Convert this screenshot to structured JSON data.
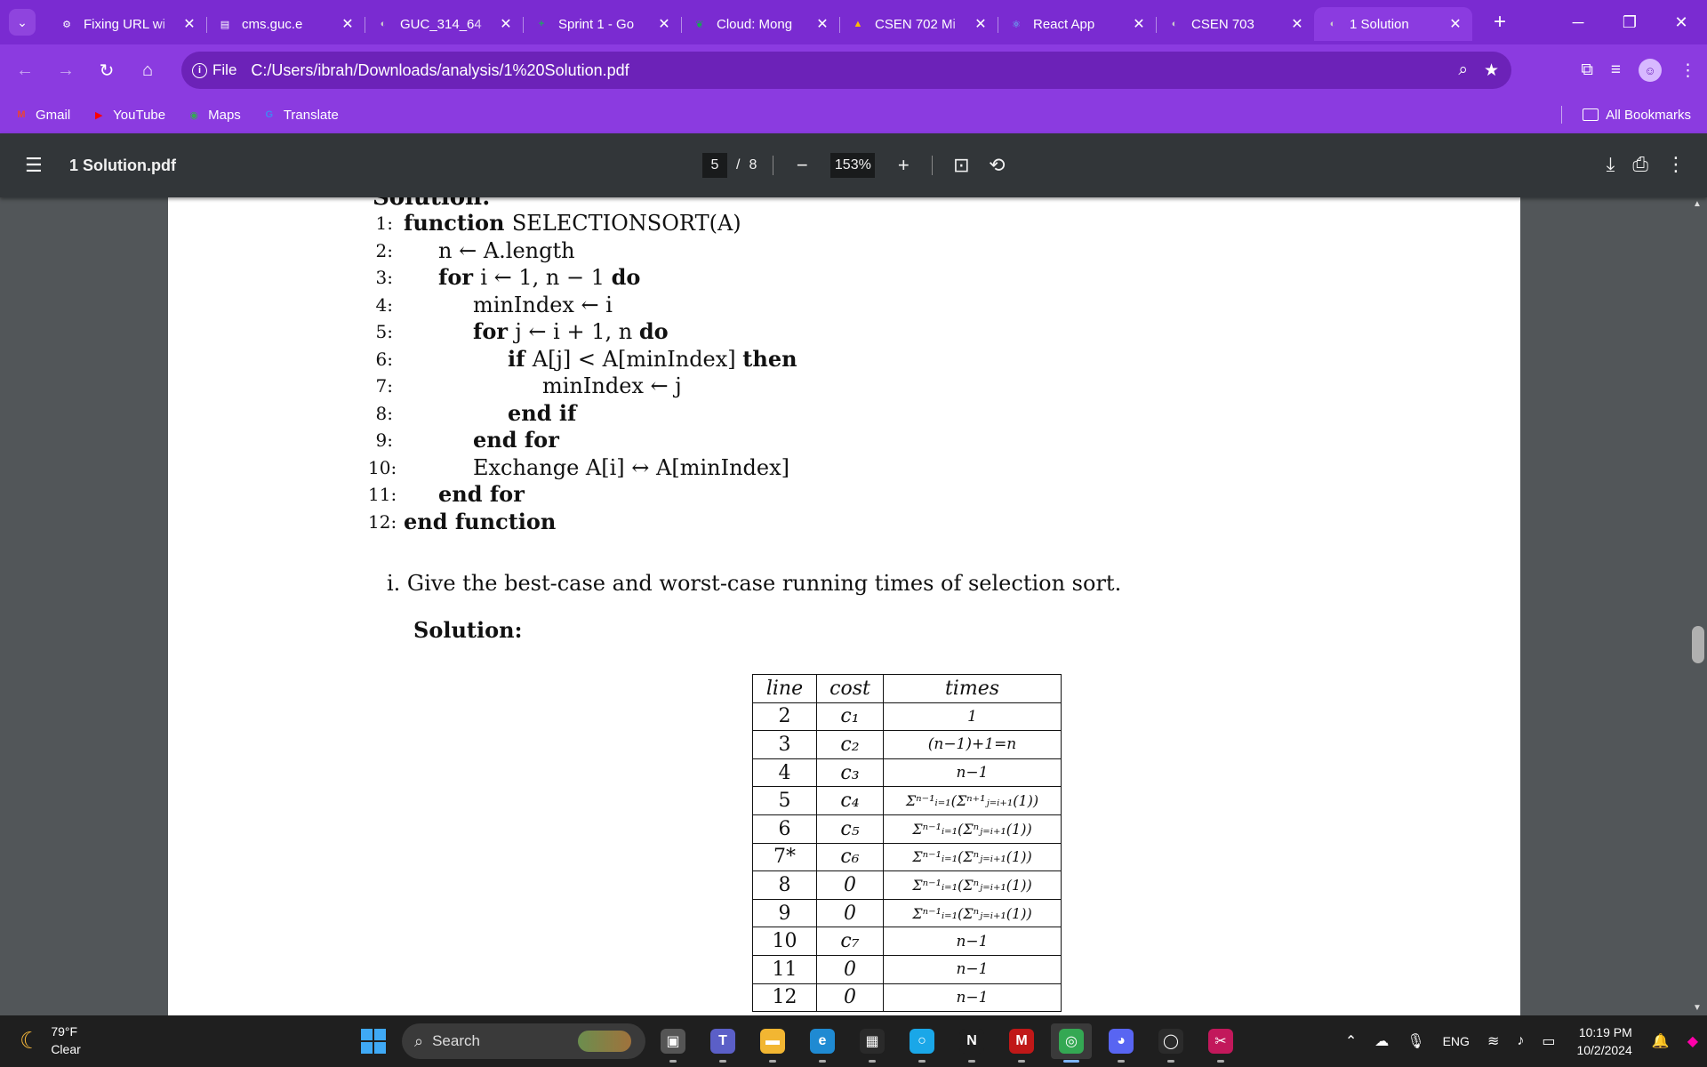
{
  "browser": {
    "tabs": [
      {
        "title": "Fixing URL wi",
        "icon": "openai-icon",
        "color": "#ffffff",
        "glyph": "⚙"
      },
      {
        "title": "cms.guc.e",
        "icon": "document-icon",
        "color": "#ffffff",
        "glyph": "▤"
      },
      {
        "title": "GUC_314_64",
        "icon": "globe-icon",
        "color": "#cccccc",
        "glyph": "◐"
      },
      {
        "title": "Sprint 1 - Go",
        "icon": "sheets-icon",
        "color": "#1fa463",
        "glyph": "+"
      },
      {
        "title": "Cloud: Mong",
        "icon": "mongodb-icon",
        "color": "#13aa52",
        "glyph": "❦"
      },
      {
        "title": "CSEN 702 Mi",
        "icon": "drive-icon",
        "color": "#fbbc04",
        "glyph": "▲"
      },
      {
        "title": "React App",
        "icon": "react-icon",
        "color": "#61dafb",
        "glyph": "⚛"
      },
      {
        "title": "CSEN 703",
        "icon": "globe-icon",
        "color": "#cccccc",
        "glyph": "◐"
      },
      {
        "title": "1 Solution",
        "icon": "globe-icon",
        "color": "#cccccc",
        "glyph": "◐",
        "active": true
      }
    ],
    "address": {
      "chip_label": "File",
      "url": "C:/Users/ibrah/Downloads/analysis/1%20Solution.pdf"
    },
    "bookmarks": [
      {
        "label": "Gmail",
        "icon": "gmail-icon",
        "glyph": "M",
        "color": "#ea4335"
      },
      {
        "label": "YouTube",
        "icon": "youtube-icon",
        "glyph": "▶",
        "color": "#ff0000"
      },
      {
        "label": "Maps",
        "icon": "maps-icon",
        "glyph": "◉",
        "color": "#34a853"
      },
      {
        "label": "Translate",
        "icon": "translate-icon",
        "glyph": "G",
        "color": "#4285f4"
      }
    ],
    "all_bookmarks_label": "All Bookmarks"
  },
  "pdf_viewer": {
    "file_name": "1 Solution.pdf",
    "current_page": "5",
    "page_separator": "/",
    "total_pages": "8",
    "zoom": "153%"
  },
  "document": {
    "clipped_heading": "Solution:",
    "algorithm": [
      {
        "n": "1:",
        "indent": 0,
        "parts": [
          {
            "b": true,
            "t": "function "
          },
          {
            "t": "SELECTIONSORT(A)"
          }
        ]
      },
      {
        "n": "2:",
        "indent": 1,
        "parts": [
          {
            "t": "n ← A.length"
          }
        ]
      },
      {
        "n": "3:",
        "indent": 1,
        "parts": [
          {
            "b": true,
            "t": "for "
          },
          {
            "t": "i ← 1, n − 1 "
          },
          {
            "b": true,
            "t": "do"
          }
        ]
      },
      {
        "n": "4:",
        "indent": 2,
        "parts": [
          {
            "t": "minIndex ← i"
          }
        ]
      },
      {
        "n": "5:",
        "indent": 2,
        "parts": [
          {
            "b": true,
            "t": "for "
          },
          {
            "t": "j ← i + 1, n "
          },
          {
            "b": true,
            "t": "do"
          }
        ]
      },
      {
        "n": "6:",
        "indent": 3,
        "parts": [
          {
            "b": true,
            "t": "if "
          },
          {
            "t": "A[j] < A[minIndex] "
          },
          {
            "b": true,
            "t": "then"
          }
        ]
      },
      {
        "n": "7:",
        "indent": 4,
        "parts": [
          {
            "t": "minIndex ← j"
          }
        ]
      },
      {
        "n": "8:",
        "indent": 3,
        "parts": [
          {
            "b": true,
            "t": "end if"
          }
        ]
      },
      {
        "n": "9:",
        "indent": 2,
        "parts": [
          {
            "b": true,
            "t": "end for"
          }
        ]
      },
      {
        "n": "10:",
        "indent": 2,
        "parts": [
          {
            "t": "Exchange A[i] ↔ A[minIndex]"
          }
        ]
      },
      {
        "n": "11:",
        "indent": 1,
        "parts": [
          {
            "b": true,
            "t": "end for"
          }
        ]
      },
      {
        "n": "12:",
        "indent": 0,
        "parts": [
          {
            "b": true,
            "t": "end function"
          }
        ]
      }
    ],
    "question": "i. Give the best-case and worst-case running times of selection sort.",
    "solution_label": "Solution:",
    "table": {
      "headers": [
        "line",
        "cost",
        "times"
      ],
      "rows": [
        {
          "line": "2",
          "cost": "c₁",
          "times": "1"
        },
        {
          "line": "3",
          "cost": "c₂",
          "times": "(n−1)+1=n"
        },
        {
          "line": "4",
          "cost": "c₃",
          "times": "n−1"
        },
        {
          "line": "5",
          "cost": "c₄",
          "times": "Σⁿ⁻¹ᵢ₌₁(Σⁿ⁺¹ⱼ₌ᵢ₊₁(1))"
        },
        {
          "line": "6",
          "cost": "c₅",
          "times": "Σⁿ⁻¹ᵢ₌₁(Σⁿⱼ₌ᵢ₊₁(1))"
        },
        {
          "line": "7*",
          "cost": "c₆",
          "times": "Σⁿ⁻¹ᵢ₌₁(Σⁿⱼ₌ᵢ₊₁(1))"
        },
        {
          "line": "8",
          "cost": "0",
          "times": "Σⁿ⁻¹ᵢ₌₁(Σⁿⱼ₌ᵢ₊₁(1))"
        },
        {
          "line": "9",
          "cost": "0",
          "times": "Σⁿ⁻¹ᵢ₌₁(Σⁿⱼ₌ᵢ₊₁(1))"
        },
        {
          "line": "10",
          "cost": "c₇",
          "times": "n−1"
        },
        {
          "line": "11",
          "cost": "0",
          "times": "n−1"
        },
        {
          "line": "12",
          "cost": "0",
          "times": "n−1"
        }
      ]
    }
  },
  "taskbar": {
    "temperature": "79°F",
    "condition": "Clear",
    "search_placeholder": "Search",
    "apps": [
      {
        "name": "task-view-icon",
        "glyph": "▣",
        "bg": "#555555"
      },
      {
        "name": "teams-icon",
        "glyph": "T",
        "bg": "#5b5fc7"
      },
      {
        "name": "file-explorer-icon",
        "glyph": "▬",
        "bg": "#f2b632"
      },
      {
        "name": "edge-icon",
        "glyph": "e",
        "bg": "#1f8ad2"
      },
      {
        "name": "store-icon",
        "glyph": "▦",
        "bg": "#2a2a2a"
      },
      {
        "name": "cortana-icon",
        "glyph": "○",
        "bg": "#1aa7e8"
      },
      {
        "name": "netflix-icon",
        "glyph": "N",
        "bg": "#1f1f1f"
      },
      {
        "name": "mcafee-icon",
        "glyph": "M",
        "bg": "#c01818"
      },
      {
        "name": "chrome-icon",
        "glyph": "◎",
        "bg": "#34a853",
        "active": true
      },
      {
        "name": "discord-icon",
        "glyph": "◕",
        "bg": "#5865f2"
      },
      {
        "name": "github-icon",
        "glyph": "◯",
        "bg": "#2b2b2b"
      },
      {
        "name": "snipping-tool-icon",
        "glyph": "✂",
        "bg": "#c2185b"
      }
    ],
    "language": "ENG",
    "time": "10:19 PM",
    "date": "10/2/2024"
  }
}
